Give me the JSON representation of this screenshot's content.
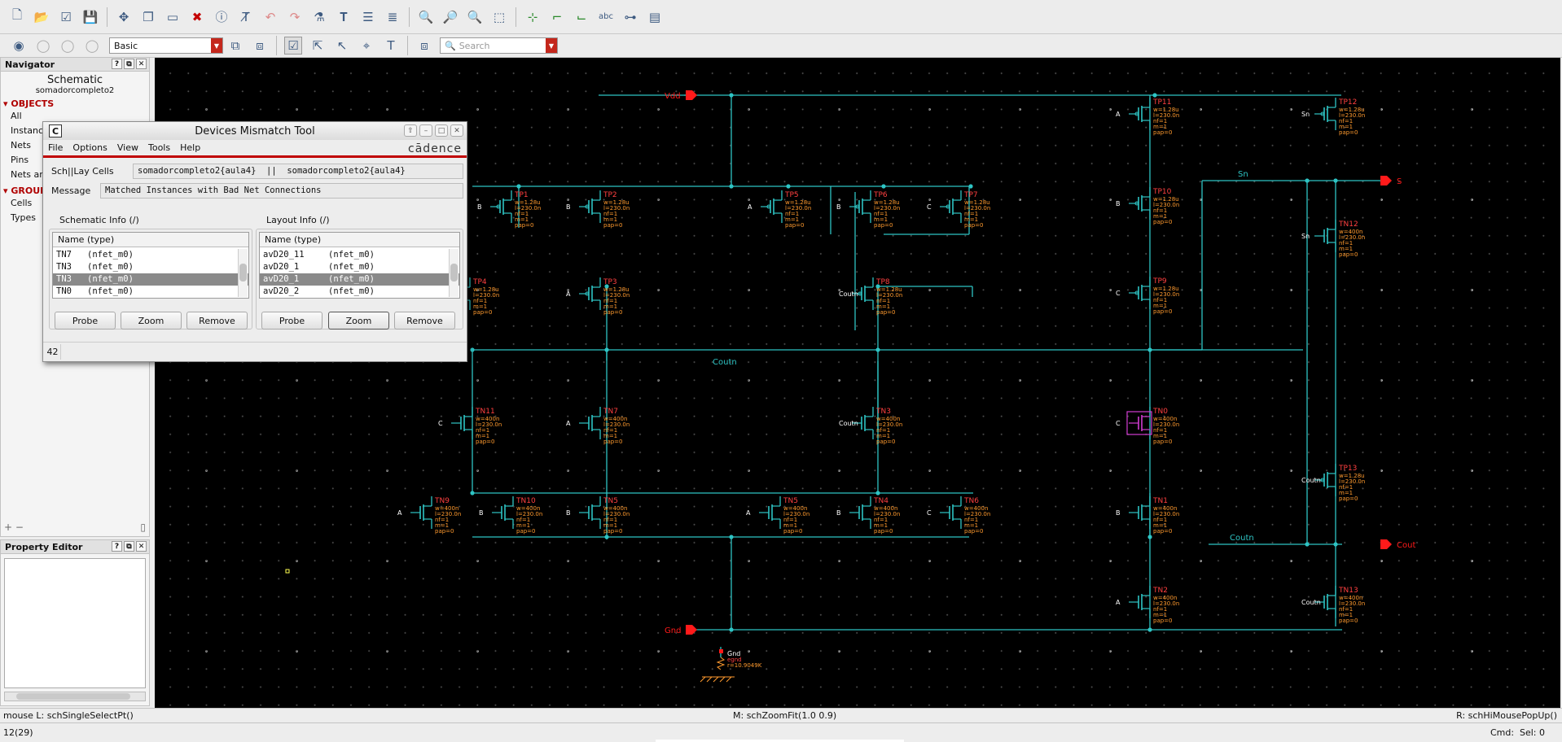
{
  "toolbar2": {
    "workspace": "Basic",
    "search_placeholder": "Search"
  },
  "navigator": {
    "title": "Navigator",
    "heading": "Schematic",
    "cell": "somadorcompleto2",
    "objects": "OBJECTS",
    "items": [
      "All",
      "Instances",
      "Nets",
      "Pins",
      "Nets and..."
    ],
    "groups": "GROUPS",
    "group_items": [
      "Cells",
      "Types"
    ]
  },
  "property_editor": {
    "title": "Property Editor"
  },
  "dialog": {
    "title": "Devices Mismatch Tool",
    "brand": "cādence",
    "menu": [
      "File",
      "Options",
      "View",
      "Tools",
      "Help"
    ],
    "cells_label": "Sch||Lay Cells",
    "cells_value": "somadorcompleto2{aula4}  ||  somadorcompleto2{aula4}",
    "message_label": "Message",
    "message_value": "Matched Instances with Bad Net Connections",
    "sch_label": "Schematic Info (/)",
    "lay_label": "Layout Info (/)",
    "col_header": "Name  (type)",
    "sch_items": [
      {
        "name": "TN7",
        "type": "(nfet_m0)"
      },
      {
        "name": "TN3",
        "type": "(nfet_m0)"
      },
      {
        "name": "TN3",
        "type": "(nfet_m0)"
      },
      {
        "name": "TN0",
        "type": "(nfet_m0)"
      }
    ],
    "lay_items": [
      {
        "name": "avD20_11",
        "type": "(nfet_m0)"
      },
      {
        "name": "avD20_1",
        "type": "(nfet_m0)"
      },
      {
        "name": "avD20_1",
        "type": "(nfet_m0)"
      },
      {
        "name": "avD20_2",
        "type": "(nfet_m0)"
      }
    ],
    "btn_probe": "Probe",
    "btn_zoom": "Zoom",
    "btn_remove": "Remove",
    "count": "42"
  },
  "schematic": {
    "colors": {
      "wire": "#2ec4c4",
      "inst": "#ff4040",
      "param": "#ff9a2e",
      "net": "#ffffff",
      "pin": "#ff1a1a",
      "select": "#d23cd2"
    },
    "pins": [
      "Vdd",
      "Gnd",
      "S",
      "Cout"
    ],
    "wire_labels": [
      "Coutn",
      "Sn",
      "Coutn"
    ],
    "instances": [
      {
        "name": "TP1",
        "gate": "B",
        "type": "p"
      },
      {
        "name": "TP2",
        "gate": "B",
        "type": "p"
      },
      {
        "name": "TP5",
        "gate": "A",
        "type": "p"
      },
      {
        "name": "TP6",
        "gate": "B",
        "type": "p"
      },
      {
        "name": "TP7",
        "gate": "C",
        "type": "p"
      },
      {
        "name": "TP4",
        "gate": "",
        "type": "p"
      },
      {
        "name": "TP3",
        "gate": "A",
        "type": "p"
      },
      {
        "name": "TP8",
        "gate": "Coutn",
        "type": "p"
      },
      {
        "name": "TN11",
        "gate": "C",
        "type": "n"
      },
      {
        "name": "TN7",
        "gate": "A",
        "type": "n"
      },
      {
        "name": "TN3",
        "gate": "Coutn",
        "type": "n"
      },
      {
        "name": "TN9",
        "gate": "A",
        "type": "n"
      },
      {
        "name": "TN10",
        "gate": "B",
        "type": "n"
      },
      {
        "name": "TN5",
        "gate": "B",
        "type": "n"
      },
      {
        "name": "TN5",
        "gate": "A",
        "type": "n"
      },
      {
        "name": "TN4",
        "gate": "B",
        "type": "n"
      },
      {
        "name": "TN6",
        "gate": "C",
        "type": "n"
      },
      {
        "name": "TP11",
        "gate": "A",
        "type": "p"
      },
      {
        "name": "TP10",
        "gate": "B",
        "type": "p"
      },
      {
        "name": "TP9",
        "gate": "C",
        "type": "p"
      },
      {
        "name": "TN0",
        "gate": "C",
        "type": "n"
      },
      {
        "name": "TN1",
        "gate": "B",
        "type": "n"
      },
      {
        "name": "TN2",
        "gate": "A",
        "type": "n"
      },
      {
        "name": "TP12",
        "gate": "Sn",
        "type": "p"
      },
      {
        "name": "TN12",
        "gate": "Sn",
        "type": "n"
      },
      {
        "name": "TP13",
        "gate": "Coutn",
        "type": "p"
      },
      {
        "name": "TN13",
        "gate": "Coutn",
        "type": "n"
      }
    ],
    "pparams": [
      "w=1.28u",
      "l=230.0n",
      "nf=1",
      "m=1",
      "pap=0"
    ],
    "nparams": [
      "w=400n",
      "l=230.0n",
      "nf=1",
      "m=1",
      "pap=0"
    ],
    "res": {
      "name": "Gnd",
      "model": "egnd",
      "value": "r=10.9049K"
    }
  },
  "status": {
    "left": "mouse L: schSingleSelectPt()",
    "mid": "M: schZoomFit(1.0 0.9)",
    "right": "R: schHiMousePopUp()",
    "counter": "12(29)",
    "cmd": "Cmd:",
    "sel": "Sel: 0"
  }
}
